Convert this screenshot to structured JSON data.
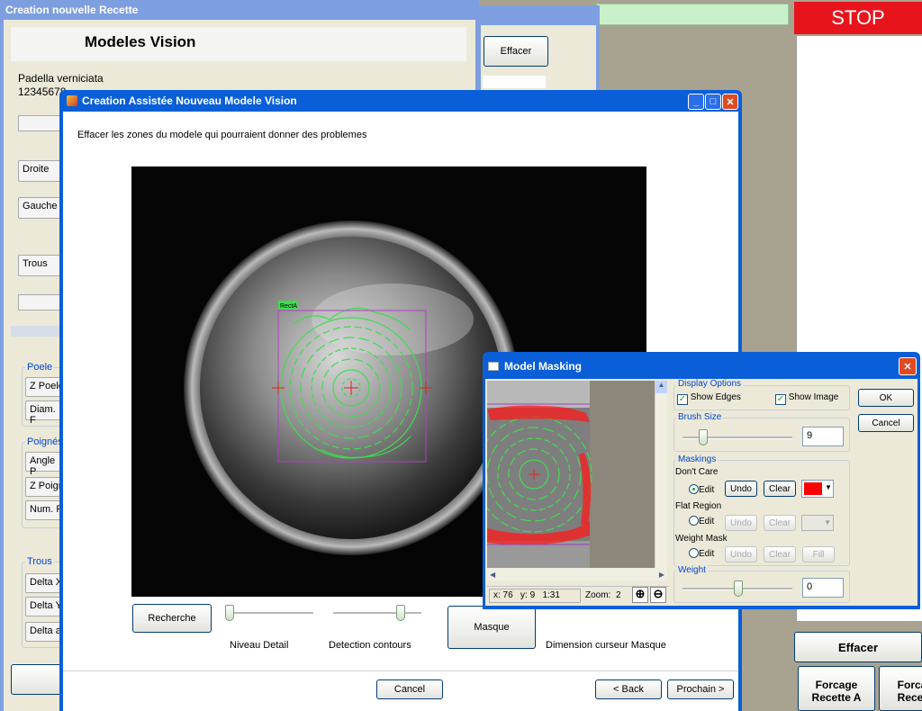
{
  "bg_left_window": {
    "title": "Creation nouvelle Recette",
    "heading": "Modeles Vision",
    "name": "Padella verniciata",
    "code": "12345678",
    "buttons": [
      "Droite",
      "Gauche",
      "Trous"
    ],
    "groups": {
      "poele": {
        "label": "Poele",
        "fields": [
          "Z Poele",
          "Diam. F"
        ]
      },
      "poignees": {
        "label": "Poignés",
        "fields": [
          "Angle P",
          "Z Poign",
          "Num. R"
        ]
      },
      "trous": {
        "label": "Trous",
        "fields": [
          "Delta X",
          "Delta Y",
          "Delta a"
        ]
      }
    }
  },
  "bg_right": {
    "effacer_top": "Effacer",
    "stop": "STOP",
    "effacer_bottom": "Effacer",
    "forcage_a": "Forcage Recette A",
    "forcage_b": "Forca Recet"
  },
  "wizard": {
    "title": "Creation Assistée Nouveau Modele Vision",
    "instruction": "Effacer les zones du modele qui pourraient donner des problemes",
    "roi_label": "RectA",
    "recherche": "Recherche",
    "niveau_detail": "Niveau Detail",
    "detection_contours": "Detection contours",
    "masque": "Masque",
    "dimension": "Dimension curseur Masque",
    "cancel": "Cancel",
    "back": "< Back",
    "next": "Prochain >",
    "slider_niveau": 0.0,
    "slider_detection": 0.8
  },
  "masking": {
    "title": "Model Masking",
    "display_options": "Display Options",
    "show_edges": "Show Edges",
    "show_image": "Show Image",
    "ok": "OK",
    "cancel": "Cancel",
    "brush_size_label": "Brush Size",
    "brush_size": "9",
    "maskings": "Maskings",
    "dont_care": "Don't Care",
    "flat_region": "Flat Region",
    "weight_mask": "Weight Mask",
    "edit": "Edit",
    "undo": "Undo",
    "clear": "Clear",
    "fill": "Fill",
    "weight_label": "Weight",
    "weight": "0",
    "status_xy": "x: 76   y: 9   1:31",
    "zoom_label": "Zoom:",
    "zoom": "2",
    "dont_care_color": "#ff0000"
  },
  "colors": {
    "titlebar_active": "#0a5fd8",
    "titlebar_inactive": "#7d9fe0",
    "stop": "#e8141c",
    "edge": "#39b54a",
    "roi": "#7a2a8a"
  }
}
